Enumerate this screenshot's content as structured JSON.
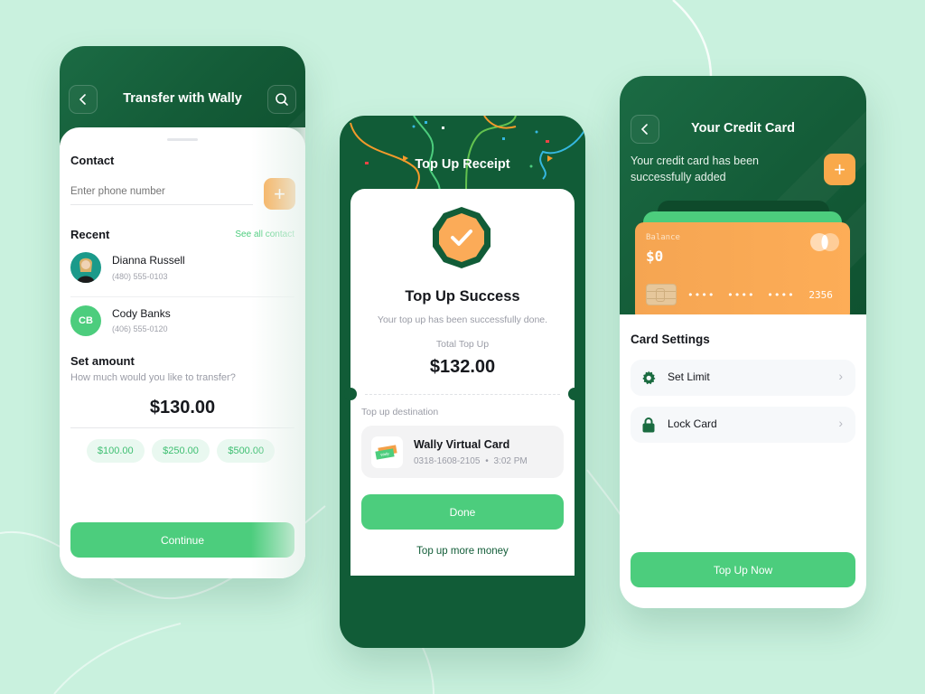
{
  "colors": {
    "background": "#c9f1de",
    "dark_green": "#115c37",
    "accent_green": "#4ccd7d",
    "orange": "#f9a94b",
    "chip_bg": "#e9f8f0"
  },
  "transfer": {
    "header_title": "Transfer with Wally",
    "back_icon": "chevron-left-icon",
    "search_icon": "search-icon",
    "contact_title": "Contact",
    "phone_placeholder": "Enter phone number",
    "add_icon": "plus-icon",
    "recent_title": "Recent",
    "see_all": "See all contact",
    "contacts": [
      {
        "name": "Dianna Russell",
        "phone": "(480) 555-0103",
        "initials": "",
        "avatar": "photo"
      },
      {
        "name": "Cody Banks",
        "phone": "(406) 555-0120",
        "initials": "CB",
        "avatar": "initials"
      }
    ],
    "amount_title": "Set amount",
    "amount_subtitle": "How much would you like to transfer?",
    "amount_value": "$130.00",
    "quick_amounts": [
      "$100.00",
      "$250.00",
      "$500.00"
    ],
    "continue_label": "Continue"
  },
  "receipt": {
    "header_title": "Top Up Receipt",
    "success_title": "Top Up Success",
    "success_subtitle": "Your top up has been successfully done.",
    "total_label": "Total Top Up",
    "total_value": "$132.00",
    "destination_label": "Top up destination",
    "card_name": "Wally Virtual Card",
    "card_number": "0318-1608-2105",
    "separator": "•",
    "time": "3:02 PM",
    "card_logo_text": "Wally",
    "done_label": "Done",
    "more_label": "Top up more money"
  },
  "credit_card": {
    "header_title": "Your Credit Card",
    "message": "Your credit card has been successfully added",
    "balance_label": "Balance",
    "balance_value": "$0",
    "masked_groups": [
      "••••",
      "••••",
      "••••"
    ],
    "last_digits": "2356",
    "settings_title": "Card Settings",
    "settings": [
      {
        "label": "Set Limit",
        "icon": "gear-icon"
      },
      {
        "label": "Lock Card",
        "icon": "lock-icon"
      }
    ],
    "top_up_label": "Top Up Now"
  }
}
